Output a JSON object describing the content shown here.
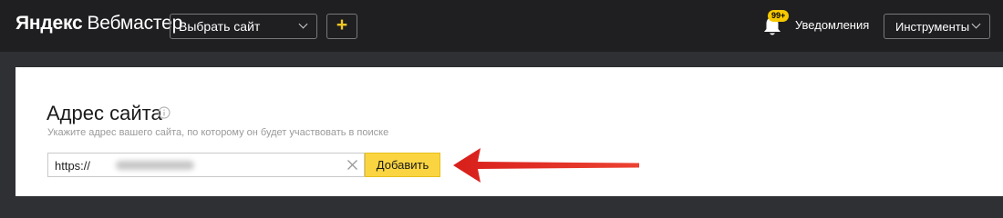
{
  "header": {
    "logo_brand": "Яндекс",
    "logo_product": "Вебмастер",
    "site_select_label": "Выбрать сайт",
    "add_site_symbol": "+",
    "notifications_badge": "99+",
    "notifications_label": "Уведомления",
    "tools_label": "Инструменты",
    "icons": {
      "site_select": "chevron-down-icon",
      "notifications": "bell-icon",
      "tools": "chevron-down-icon"
    }
  },
  "main": {
    "title": "Адрес сайта",
    "hint": "Укажите адрес вашего сайта, по которому он будет участвовать в поиске",
    "url_input_value": "https://",
    "add_button_label": "Добавить",
    "icons": {
      "title_info": "info-icon",
      "clear": "close-icon"
    }
  },
  "colors": {
    "header_bg": "#1f1f21",
    "page_bg": "#2f3033",
    "accent_yellow": "#fbd541",
    "badge_yellow": "#f5c800",
    "plus_yellow": "#f3c624",
    "arrow_red": "#e02a20"
  }
}
